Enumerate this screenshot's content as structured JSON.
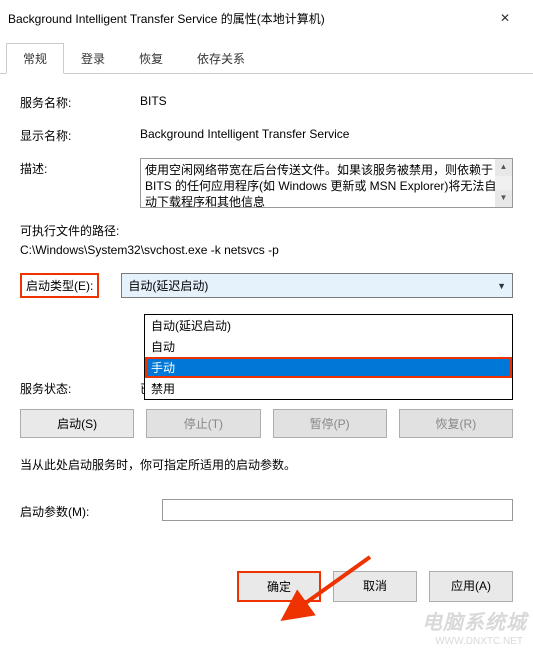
{
  "title": "Background Intelligent Transfer Service 的属性(本地计算机)",
  "tabs": {
    "general": "常规",
    "logon": "登录",
    "recovery": "恢复",
    "deps": "依存关系"
  },
  "labels": {
    "service_name": "服务名称:",
    "display_name": "显示名称:",
    "description": "描述:",
    "exec_path": "可执行文件的路径:",
    "startup_type": "启动类型(E):",
    "service_status": "服务状态:",
    "start_params": "启动参数(M):"
  },
  "values": {
    "service_name": "BITS",
    "display_name": "Background Intelligent Transfer Service",
    "description": "使用空闲网络带宽在后台传送文件。如果该服务被禁用，则依赖于 BITS 的任何应用程序(如 Windows 更新或 MSN Explorer)将无法自动下载程序和其他信息",
    "exec_path": "C:\\Windows\\System32\\svchost.exe -k netsvcs -p",
    "startup_selected": "自动(延迟启动)",
    "service_status": "已停止"
  },
  "startup_options": {
    "auto_delayed": "自动(延迟启动)",
    "auto": "自动",
    "manual": "手动",
    "disabled": "禁用"
  },
  "buttons": {
    "start": "启动(S)",
    "stop": "停止(T)",
    "pause": "暂停(P)",
    "resume": "恢复(R)",
    "ok": "确定",
    "cancel": "取消",
    "apply": "应用(A)"
  },
  "note": "当从此处启动服务时，你可指定所适用的启动参数。",
  "watermark": "电脑系统城",
  "watermark_url": "WWW.DNXTC.NET"
}
